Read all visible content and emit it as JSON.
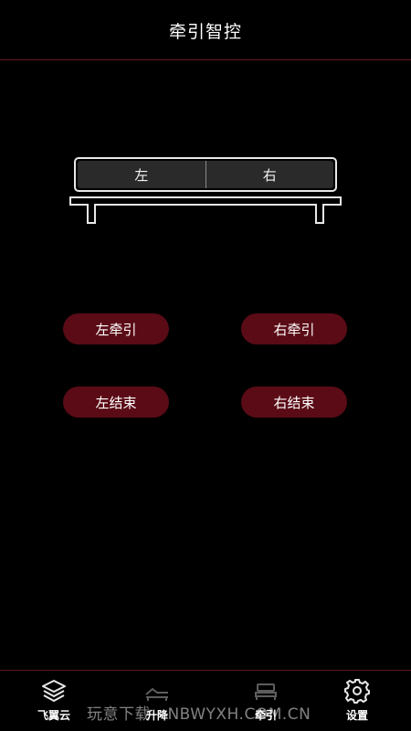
{
  "header": {
    "title": "牵引智控"
  },
  "bed": {
    "left_zone": "左",
    "right_zone": "右"
  },
  "controls": {
    "left_traction": "左牵引",
    "right_traction": "右牵引",
    "left_end": "左结束",
    "right_end": "右结束"
  },
  "tabs": [
    {
      "label": "飞翼云",
      "icon": "layers-icon"
    },
    {
      "label": "升降",
      "icon": "adjustable-bed-icon"
    },
    {
      "label": "牵引",
      "icon": "bed-icon"
    },
    {
      "label": "设置",
      "icon": "gear-icon"
    }
  ],
  "watermark": "玩意下载 - NBWYXH.COM.CN",
  "colors": {
    "background": "#000000",
    "accent": "#5a0b16",
    "divider": "#6b1a22"
  }
}
